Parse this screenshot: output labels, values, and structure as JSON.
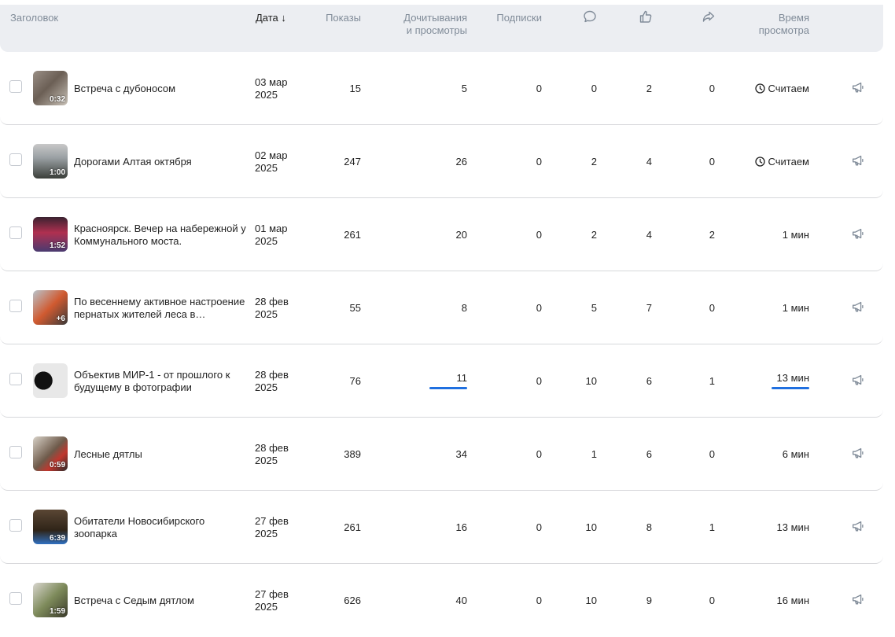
{
  "header": {
    "title": "Заголовок",
    "date": "Дата",
    "sort_arrow": "↓",
    "views": "Показы",
    "reads_line1": "Дочитывания",
    "reads_line2": "и просмотры",
    "subs": "Подписки",
    "comments_icon": "comment-icon",
    "likes_icon": "like-icon",
    "shares_icon": "share-icon",
    "time_line1": "Время",
    "time_line2": "просмотра"
  },
  "rows": [
    {
      "title": "Встреча с дубоносом",
      "duration": "0:32",
      "date_line1": "03 мар",
      "date_line2": "2025",
      "views": "15",
      "reads": "5",
      "subs": "0",
      "comments": "0",
      "likes": "2",
      "shares": "0",
      "time": "Считаем",
      "time_counting": true
    },
    {
      "title": "Дорогами Алтая октября",
      "duration": "1:00",
      "date_line1": "02 мар",
      "date_line2": "2025",
      "views": "247",
      "reads": "26",
      "subs": "0",
      "comments": "2",
      "likes": "4",
      "shares": "0",
      "time": "Считаем",
      "time_counting": true
    },
    {
      "title": "Красноярск. Вечер на набережной у Коммунального моста.",
      "duration": "1:52",
      "date_line1": "01 мар",
      "date_line2": "2025",
      "views": "261",
      "reads": "20",
      "subs": "0",
      "comments": "2",
      "likes": "4",
      "shares": "2",
      "time": "1 мин",
      "time_counting": false
    },
    {
      "title": "По весеннему активное настроение пернатых жителей леса в последни…",
      "duration": "+6",
      "date_line1": "28 фев",
      "date_line2": "2025",
      "views": "55",
      "reads": "8",
      "subs": "0",
      "comments": "5",
      "likes": "7",
      "shares": "0",
      "time": "1 мин",
      "time_counting": false
    },
    {
      "title": "Объектив МИР-1 - от прошлого к будущему в фотографии",
      "duration": "",
      "date_line1": "28 фев",
      "date_line2": "2025",
      "views": "76",
      "reads": "11",
      "subs": "0",
      "comments": "10",
      "likes": "6",
      "shares": "1",
      "time": "13 мин",
      "time_counting": false
    },
    {
      "title": "Лесные дятлы",
      "duration": "0:59",
      "date_line1": "28 фев",
      "date_line2": "2025",
      "views": "389",
      "reads": "34",
      "subs": "0",
      "comments": "1",
      "likes": "6",
      "shares": "0",
      "time": "6 мин",
      "time_counting": false
    },
    {
      "title": "Обитатели Новосибирского зоопарка",
      "duration": "6:39",
      "date_line1": "27 фев",
      "date_line2": "2025",
      "views": "261",
      "reads": "16",
      "subs": "0",
      "comments": "10",
      "likes": "8",
      "shares": "1",
      "time": "13 мин",
      "time_counting": false
    },
    {
      "title": "Встреча с Седым дятлом",
      "duration": "1:59",
      "date_line1": "27 фев",
      "date_line2": "2025",
      "views": "626",
      "reads": "40",
      "subs": "0",
      "comments": "10",
      "likes": "9",
      "shares": "0",
      "time": "16 мин",
      "time_counting": false
    }
  ],
  "colors": {
    "accent": "#2070e0",
    "header_bg": "#eceef2",
    "muted_text": "#818c99"
  }
}
